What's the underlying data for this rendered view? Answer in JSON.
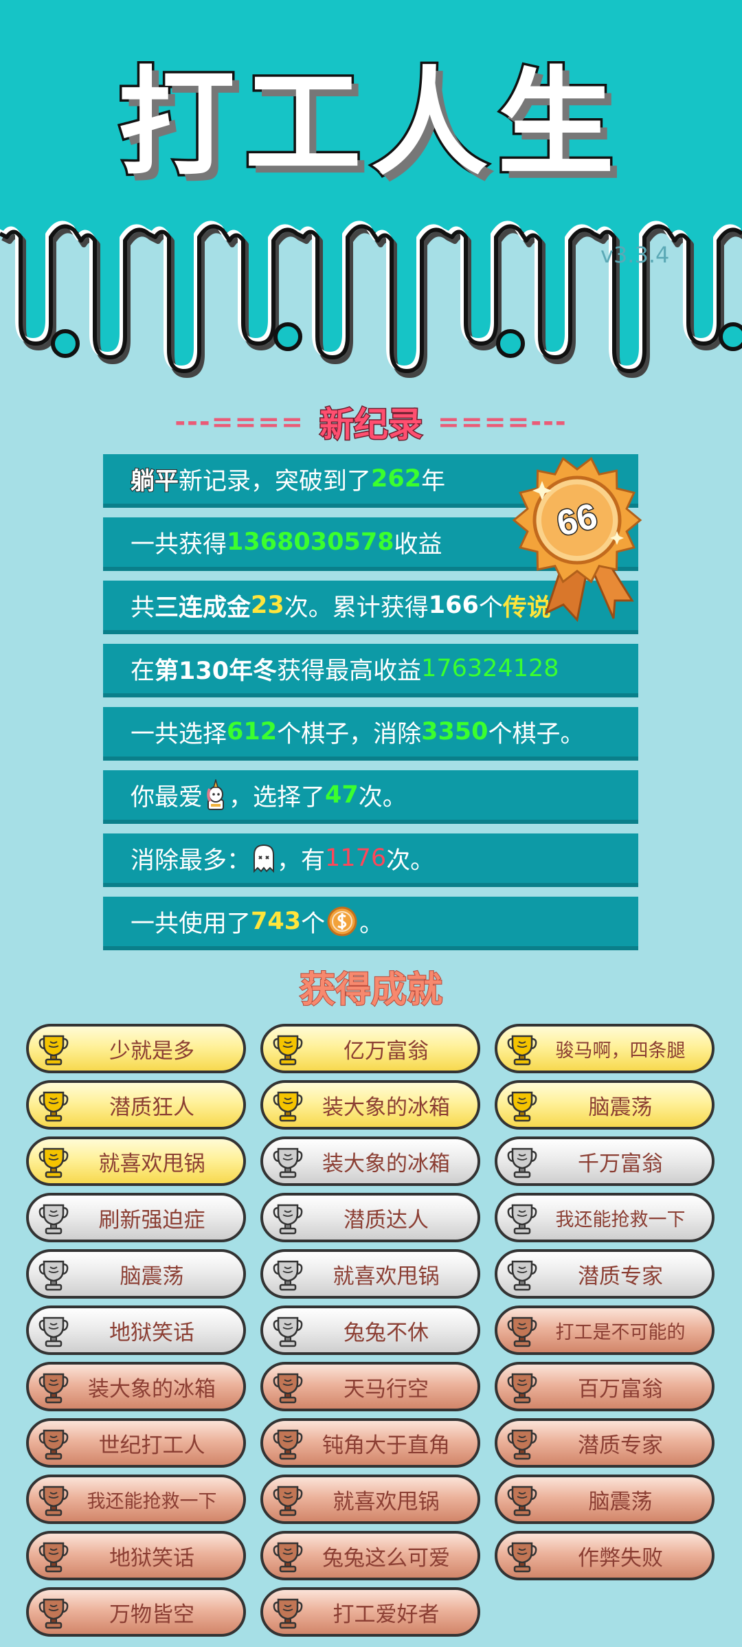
{
  "app": {
    "title": "打工人生",
    "version": "v3.3.4"
  },
  "banner": {
    "left_dashes": "---====",
    "title": "新纪录",
    "right_dashes": "====---"
  },
  "medal": {
    "value": "66"
  },
  "stats": {
    "r1": {
      "tag": "躺平",
      "pre": "新记录，突破到了",
      "num": "262",
      "post": "年"
    },
    "r2": {
      "pre": "一共获得",
      "num": "1368030578",
      "post": "收益"
    },
    "r3": {
      "pre": "共",
      "combo": "三连成金",
      "count": "23",
      "mid": "次。累计获得",
      "count2": "166",
      "mid2": "个",
      "legend": "传说"
    },
    "r4": {
      "pre": "在 ",
      "season": "第130年冬",
      "mid": " 获得最高收益",
      "num": "176324128"
    },
    "r5": {
      "pre": "一共选择",
      "num1": "612",
      "mid": "个棋子，消除",
      "num2": "3350",
      "post": "个棋子。"
    },
    "r6": {
      "pre": "你最爱",
      "mid": "，选择了",
      "num": "47",
      "post": "次。"
    },
    "r7": {
      "pre": "消除最多：",
      "mid": "，有",
      "num": "1176",
      "post": "次。"
    },
    "r8": {
      "pre": "一共使用了",
      "num": "743",
      "mid": "个",
      "post": "。"
    }
  },
  "achievements_title": "获得成就",
  "achievements": [
    {
      "label": "少就是多",
      "tier": "gold"
    },
    {
      "label": "亿万富翁",
      "tier": "gold"
    },
    {
      "label": "骏马啊，四条腿",
      "tier": "gold"
    },
    {
      "label": "潜质狂人",
      "tier": "gold"
    },
    {
      "label": "装大象的冰箱",
      "tier": "gold"
    },
    {
      "label": "脑震荡",
      "tier": "gold"
    },
    {
      "label": "就喜欢甩锅",
      "tier": "gold"
    },
    {
      "label": "装大象的冰箱",
      "tier": "silver"
    },
    {
      "label": "千万富翁",
      "tier": "silver"
    },
    {
      "label": "刷新强迫症",
      "tier": "silver"
    },
    {
      "label": "潜质达人",
      "tier": "silver"
    },
    {
      "label": "我还能抢救一下",
      "tier": "silver"
    },
    {
      "label": "脑震荡",
      "tier": "silver"
    },
    {
      "label": "就喜欢甩锅",
      "tier": "silver"
    },
    {
      "label": "潜质专家",
      "tier": "silver"
    },
    {
      "label": "地狱笑话",
      "tier": "silver"
    },
    {
      "label": "兔兔不休",
      "tier": "silver"
    },
    {
      "label": "打工是不可能的",
      "tier": "bronze"
    },
    {
      "label": "装大象的冰箱",
      "tier": "bronze"
    },
    {
      "label": "天马行空",
      "tier": "bronze"
    },
    {
      "label": "百万富翁",
      "tier": "bronze"
    },
    {
      "label": "世纪打工人",
      "tier": "bronze"
    },
    {
      "label": "钝角大于直角",
      "tier": "bronze"
    },
    {
      "label": "潜质专家",
      "tier": "bronze"
    },
    {
      "label": "我还能抢救一下",
      "tier": "bronze"
    },
    {
      "label": "就喜欢甩锅",
      "tier": "bronze"
    },
    {
      "label": "脑震荡",
      "tier": "bronze"
    },
    {
      "label": "地狱笑话",
      "tier": "bronze"
    },
    {
      "label": "兔兔这么可爱",
      "tier": "bronze"
    },
    {
      "label": "作弊失败",
      "tier": "bronze"
    },
    {
      "label": "万物皆空",
      "tier": "bronze"
    },
    {
      "label": "打工爱好者",
      "tier": "bronze"
    }
  ],
  "icons": {
    "trophy": "trophy-icon",
    "medal": "medal-icon",
    "unicorn": "unicorn-icon",
    "ghost": "ghost-icon",
    "coin": "coin-icon"
  },
  "colors": {
    "header_bg": "#16c4c6",
    "page_bg": "#a6dfe6",
    "row_bg": "#0d9aa6",
    "green": "#3bff2e",
    "yellow": "#ffe53b",
    "red": "#ff4659"
  }
}
